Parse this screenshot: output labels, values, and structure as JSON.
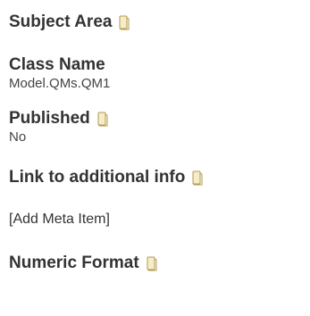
{
  "properties": {
    "subject_area": {
      "label": "Subject Area",
      "icon": "note-icon"
    },
    "class_name": {
      "label": "Class Name",
      "value": "Model.QMs.QM1"
    },
    "published": {
      "label": "Published",
      "value": "No",
      "icon": "note-icon"
    },
    "link_info": {
      "label": "Link to additional info",
      "icon": "note-icon"
    },
    "add_meta": {
      "label": "[Add Meta Item]"
    },
    "numeric_format": {
      "label": "Numeric Format",
      "icon": "note-icon"
    }
  },
  "colors": {
    "text": "#333333",
    "icon_fill": "#f5ecc9",
    "icon_stroke": "#b59a4d"
  }
}
